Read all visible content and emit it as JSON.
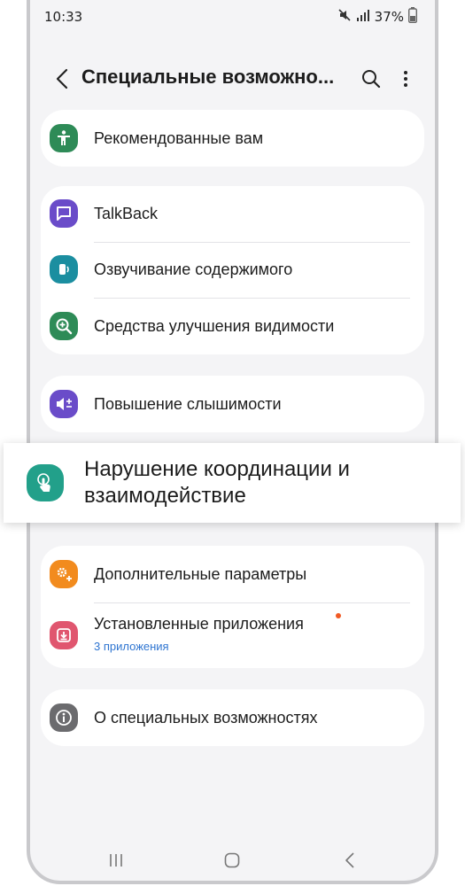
{
  "status": {
    "time": "10:33",
    "battery": "37%"
  },
  "header": {
    "title": "Специальные возможно..."
  },
  "card1": {
    "items": [
      {
        "label": "Рекомендованные вам"
      }
    ]
  },
  "card2": {
    "items": [
      {
        "label": "TalkBack"
      },
      {
        "label": "Озвучивание содержимого"
      },
      {
        "label": "Средства улучшения видимости"
      }
    ]
  },
  "card3": {
    "items": [
      {
        "label": "Повышение слышимости"
      }
    ]
  },
  "highlight": {
    "label": "Нарушение координации и взаимодействие"
  },
  "card5": {
    "items": [
      {
        "label": "Дополнительные параметры"
      },
      {
        "label": "Установленные приложения",
        "sub": "3 приложения"
      }
    ]
  },
  "card6": {
    "items": [
      {
        "label": "О специальных возможностях"
      }
    ]
  },
  "colors": {
    "accent_link": "#2f75d1",
    "notify_dot": "#f15a24",
    "green": "#2e8b57",
    "purple": "#6a4cc9",
    "teal": "#1b8ea0",
    "orange": "#f28b1e",
    "pink": "#e0566f",
    "gray": "#6b6b6e"
  }
}
